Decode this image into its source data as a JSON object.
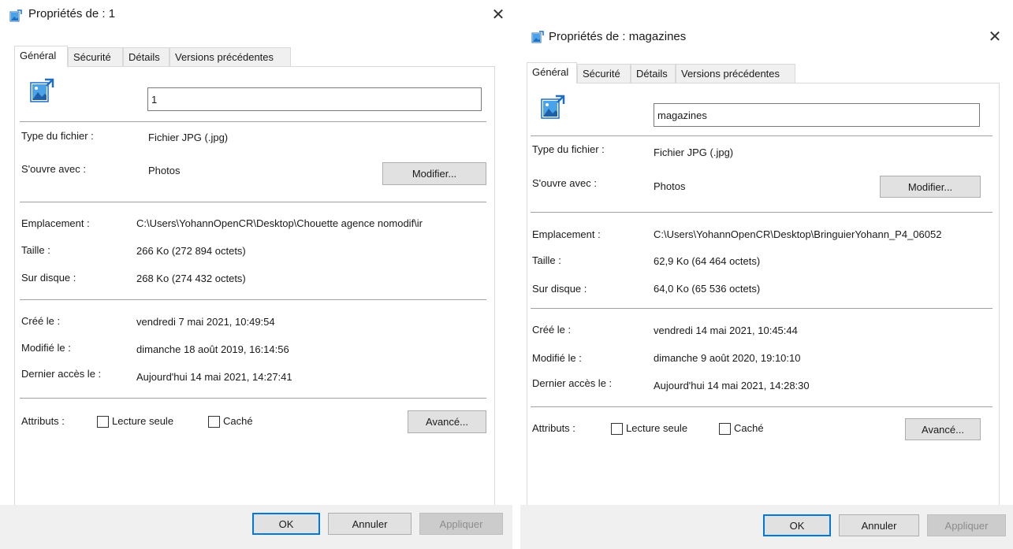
{
  "left": {
    "title": "Propriétés de : 1",
    "tabs": [
      "Général",
      "Sécurité",
      "Détails",
      "Versions précédentes"
    ],
    "file_name": "1",
    "labels": {
      "type": "Type du fichier :",
      "opens_with": "S'ouvre avec :",
      "location": "Emplacement :",
      "size": "Taille :",
      "on_disk": "Sur disque :",
      "created": "Créé le :",
      "modified": "Modifié le :",
      "accessed": "Dernier accès le :",
      "attributes": "Attributs :"
    },
    "values": {
      "type": "Fichier JPG (.jpg)",
      "opens_with": "Photos",
      "location": "C:\\Users\\YohannOpenCR\\Desktop\\Chouette agence nomodif\\ir",
      "size": "266 Ko (272 894 octets)",
      "on_disk": "268 Ko (274 432 octets)",
      "created": "vendredi 7 mai 2021, 10:49:54",
      "modified": "dimanche 18 août 2019, 16:14:56",
      "accessed": "Aujourd'hui 14 mai 2021, 14:27:41"
    },
    "buttons": {
      "modify": "Modifier...",
      "advanced": "Avancé...",
      "ok": "OK",
      "cancel": "Annuler",
      "apply": "Appliquer"
    },
    "checkboxes": {
      "read_only": "Lecture seule",
      "hidden": "Caché"
    }
  },
  "right": {
    "title": "Propriétés de : magazines",
    "tabs": [
      "Général",
      "Sécurité",
      "Détails",
      "Versions précédentes"
    ],
    "file_name": "magazines",
    "labels": {
      "type": "Type du fichier :",
      "opens_with": "S'ouvre avec :",
      "location": "Emplacement :",
      "size": "Taille :",
      "on_disk": "Sur disque :",
      "created": "Créé le :",
      "modified": "Modifié le :",
      "accessed": "Dernier accès le :",
      "attributes": "Attributs :"
    },
    "values": {
      "type": "Fichier JPG (.jpg)",
      "opens_with": "Photos",
      "location": "C:\\Users\\YohannOpenCR\\Desktop\\BringuierYohann_P4_06052",
      "size": "62,9 Ko (64 464 octets)",
      "on_disk": "64,0 Ko (65 536 octets)",
      "created": "vendredi 14 mai 2021, 10:45:44",
      "modified": "dimanche 9 août 2020, 19:10:10",
      "accessed": "Aujourd'hui 14 mai 2021, 14:28:30"
    },
    "buttons": {
      "modify": "Modifier...",
      "advanced": "Avancé...",
      "ok": "OK",
      "cancel": "Annuler",
      "apply": "Appliquer"
    },
    "checkboxes": {
      "read_only": "Lecture seule",
      "hidden": "Caché"
    }
  },
  "icons": {
    "title": "image-file-icon",
    "close": "close-icon",
    "file": "image-file-icon"
  },
  "colors": {
    "accent": "#0078d7",
    "footer": "#f0f0f0",
    "disabled": "#cccccc"
  }
}
